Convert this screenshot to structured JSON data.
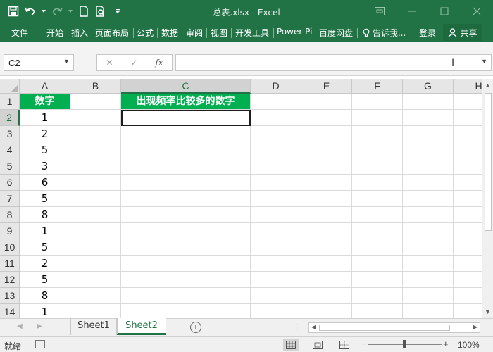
{
  "window": {
    "title": "总表.xlsx - Excel",
    "accent_color": "#217346"
  },
  "quick_access": [
    "save-icon",
    "undo-icon",
    "redo-icon",
    "new-doc-icon",
    "print-preview-icon",
    "customize-qat-icon"
  ],
  "ribbon": {
    "tabs": [
      "文件",
      "开始",
      "插入",
      "页面布局",
      "公式",
      "数据",
      "审阅",
      "视图",
      "开发工具",
      "Power Pi",
      "百度网盘"
    ],
    "tell_me": "告诉我...",
    "login": "登录",
    "share": "共享"
  },
  "formula_bar": {
    "name_box": "C2",
    "fx_label": "fx",
    "formula": ""
  },
  "grid": {
    "columns": [
      "A",
      "B",
      "C",
      "D",
      "E",
      "F",
      "G",
      "H"
    ],
    "active_column": "C",
    "rows": [
      "1",
      "2",
      "3",
      "4",
      "5",
      "6",
      "7",
      "8",
      "9",
      "10",
      "11",
      "12",
      "13",
      "14"
    ],
    "active_row": "2",
    "header_fill": "#00b050",
    "a1": "数字",
    "c1": "出现频率比较多的数字",
    "a_values": [
      "1",
      "2",
      "5",
      "3",
      "6",
      "5",
      "8",
      "1",
      "5",
      "2",
      "5",
      "8",
      "1"
    ],
    "selected_cell": "C2"
  },
  "sheets": {
    "tabs": [
      "Sheet1",
      "Sheet2"
    ],
    "active": "Sheet2"
  },
  "status": {
    "text": "就绪",
    "zoom": "100%",
    "zoom_minus": "−",
    "zoom_plus": "+"
  }
}
